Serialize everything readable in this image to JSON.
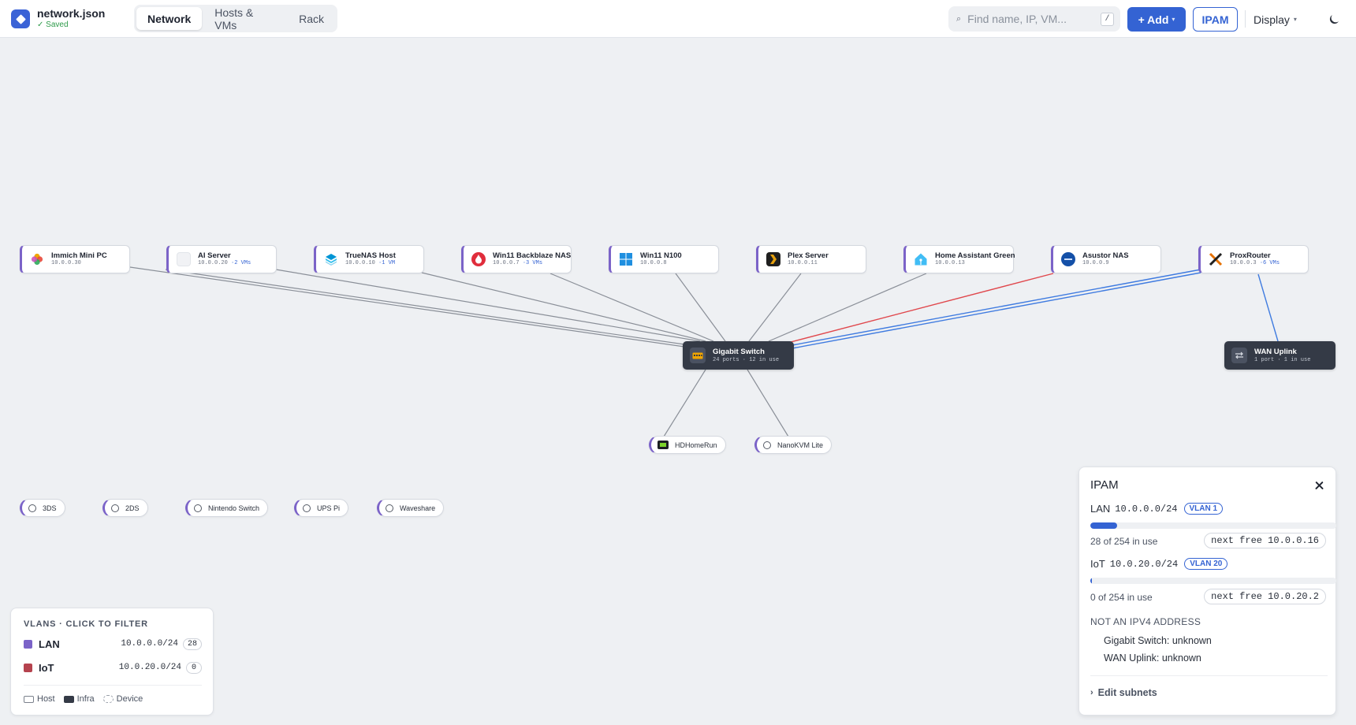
{
  "header": {
    "filename": "network.json",
    "status": "✓ Saved",
    "tabs": [
      {
        "label": "Network",
        "active": true
      },
      {
        "label": "Hosts & VMs",
        "active": false
      },
      {
        "label": "Rack",
        "active": false
      }
    ],
    "search_placeholder": "Find name, IP, VM...",
    "search_shortcut": "/",
    "add_label": "+ Add",
    "ipam_label": "IPAM",
    "display_label": "Display",
    "accent_color": "#3463d3"
  },
  "hosts": [
    {
      "name": "Immich Mini PC",
      "ip": "10.0.0.30",
      "vms": ""
    },
    {
      "name": "AI Server",
      "ip": "10.0.0.20",
      "vms": "·2 VMs"
    },
    {
      "name": "TrueNAS Host",
      "ip": "10.0.0.10",
      "vms": "·1 VM"
    },
    {
      "name": "Win11 Backblaze NAS",
      "ip": "10.0.0.7",
      "vms": "·3 VMs"
    },
    {
      "name": "Win11 N100",
      "ip": "10.0.0.8",
      "vms": ""
    },
    {
      "name": "Plex Server",
      "ip": "10.0.0.11",
      "vms": ""
    },
    {
      "name": "Home Assistant Green",
      "ip": "10.0.0.13",
      "vms": ""
    },
    {
      "name": "Asustor NAS",
      "ip": "10.0.0.9",
      "vms": ""
    },
    {
      "name": "ProxRouter",
      "ip": "10.0.0.3",
      "vms": "·6 VMs"
    }
  ],
  "infra": [
    {
      "name": "Gigabit Switch",
      "sub": "24 ports · 12 in use"
    },
    {
      "name": "WAN Uplink",
      "sub": "1 port · 1 in use"
    }
  ],
  "connected_devices": [
    {
      "name": "HDHomeRun"
    },
    {
      "name": "NanoKVM Lite"
    }
  ],
  "loose_devices": [
    {
      "name": "3DS"
    },
    {
      "name": "2DS"
    },
    {
      "name": "Nintendo Switch"
    },
    {
      "name": "UPS Pi"
    },
    {
      "name": "Waveshare"
    }
  ],
  "vlans": {
    "title": "VLANS · CLICK TO FILTER",
    "items": [
      {
        "name": "LAN",
        "cidr": "10.0.0.0/24",
        "count": "28",
        "color": "#7b63c8"
      },
      {
        "name": "IoT",
        "cidr": "10.0.20.0/24",
        "count": "0",
        "color": "#b5434e"
      }
    ],
    "legend": {
      "host": "Host",
      "infra": "Infra",
      "device": "Device"
    }
  },
  "ipam": {
    "title": "IPAM",
    "subnets": [
      {
        "name": "LAN",
        "cidr": "10.0.0.0/24",
        "vlan": "VLAN 1",
        "usage": "28 of 254 in use",
        "used_fraction": 0.11,
        "next_free": "next free 10.0.0.16"
      },
      {
        "name": "IoT",
        "cidr": "10.0.20.0/24",
        "vlan": "VLAN 20",
        "usage": "0 of 254 in use",
        "used_fraction": 0.0,
        "next_free": "next free 10.0.20.2"
      }
    ],
    "non_ipv4_title": "NOT AN IPV4 ADDRESS",
    "non_ipv4": [
      "Gigabit Switch: unknown",
      "WAN Uplink: unknown"
    ],
    "edit_label": "Edit subnets"
  },
  "link_colors": {
    "default": "#8a8f98",
    "iot": "#e0474c",
    "trunk": "#3f7be0"
  }
}
